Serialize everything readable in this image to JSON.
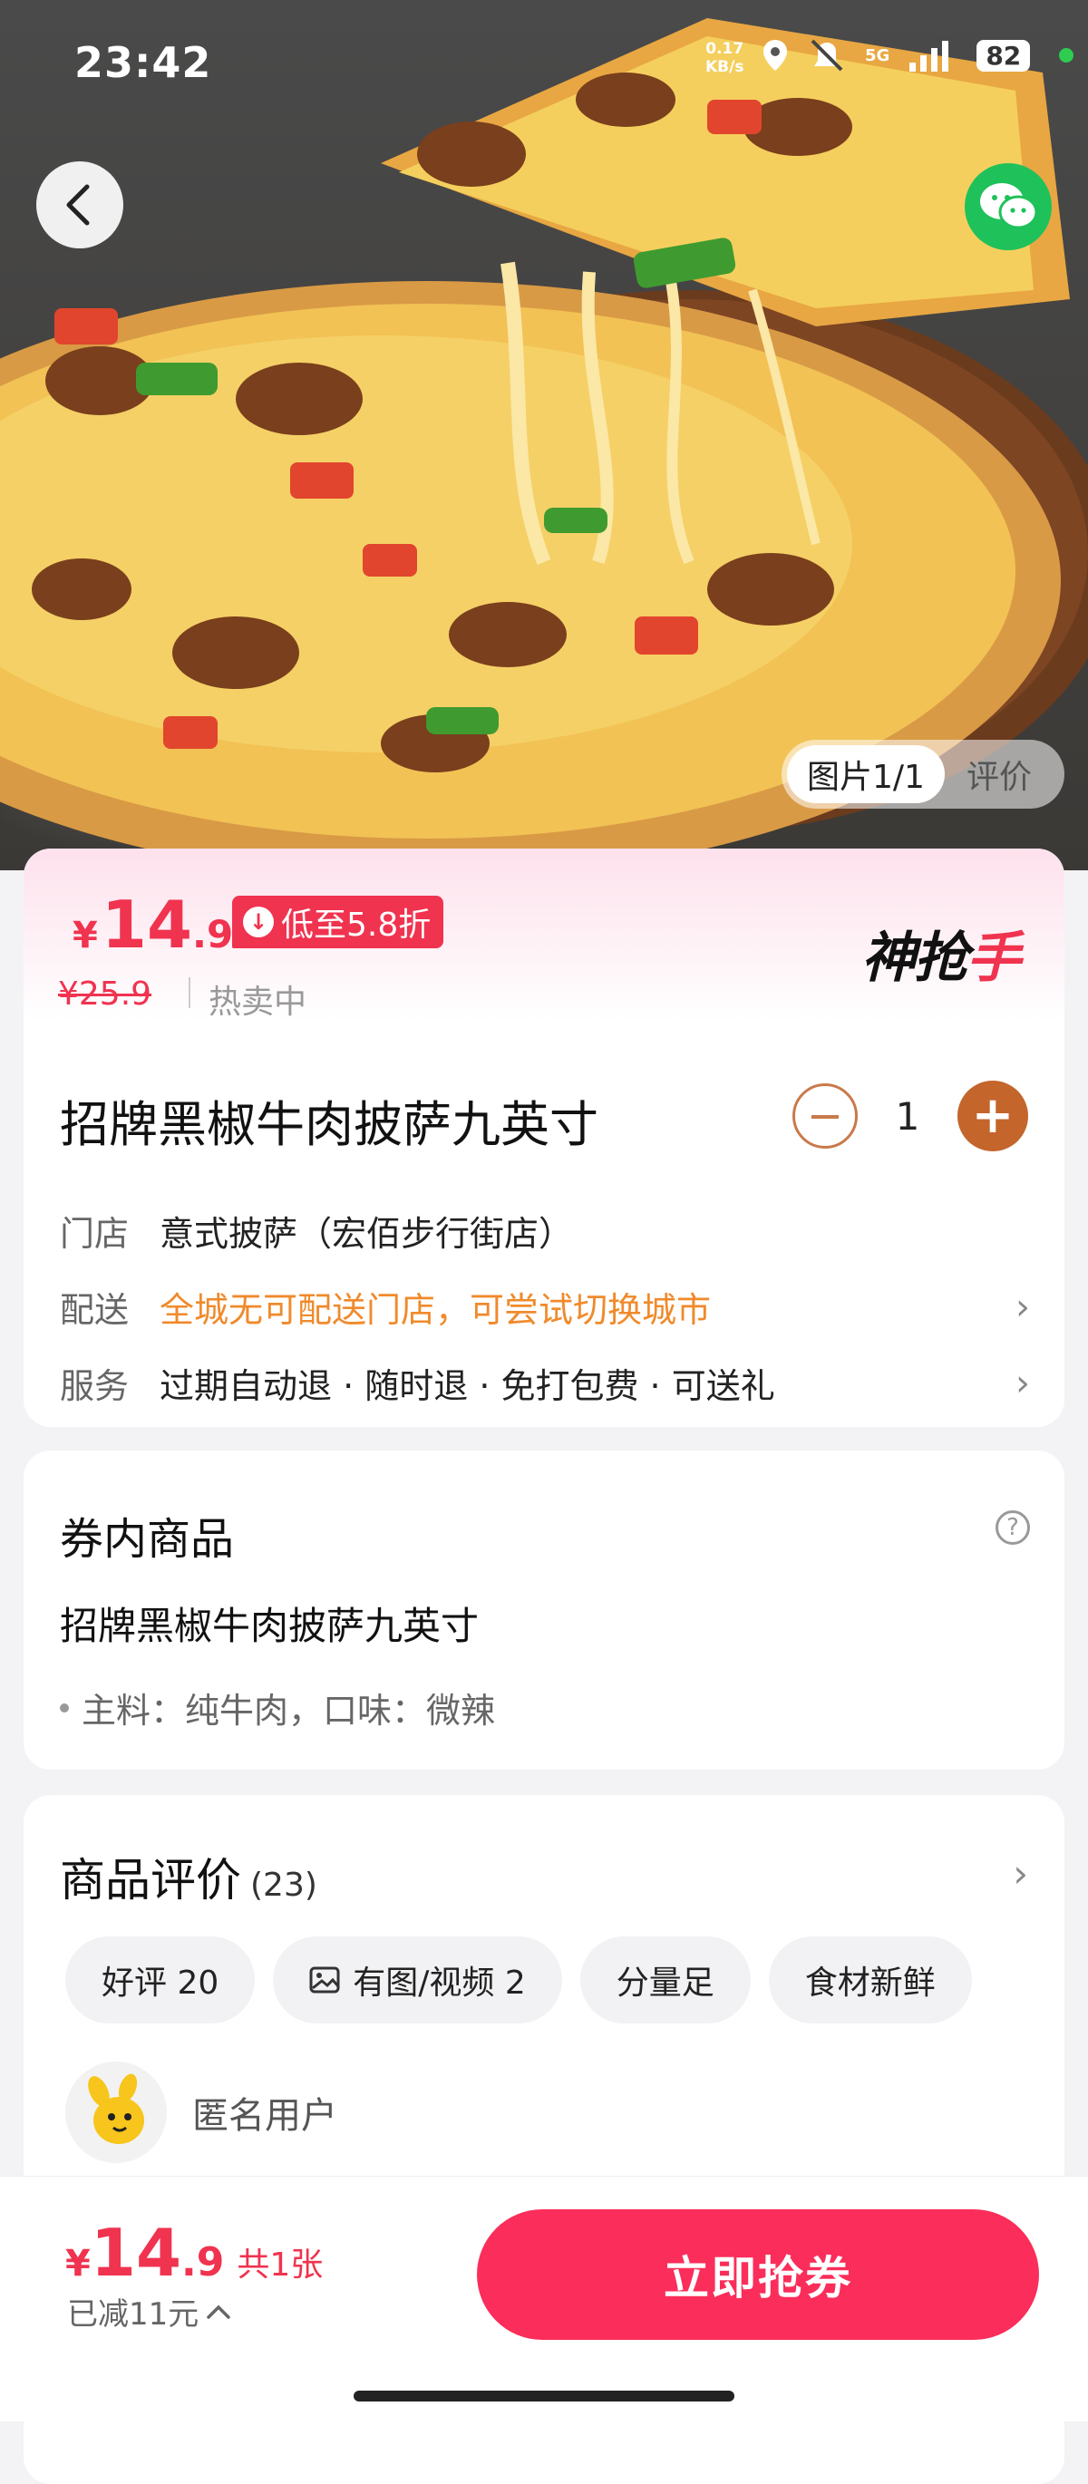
{
  "status_bar": {
    "time": "23:42",
    "net_speed_value": "0.17",
    "net_speed_unit": "KB/s",
    "network": "5G",
    "battery": "82"
  },
  "hero": {
    "image_counter": "图片1/1",
    "review_tab": "评价",
    "icons": [
      "back-icon",
      "wechat-icon"
    ]
  },
  "price": {
    "currency": "¥",
    "current_int": "14",
    "current_dec": ".9",
    "discount": "低至5.8折",
    "original": "¥25.9",
    "status": "热卖中",
    "brand_main": "神抢",
    "brand_accent": "手"
  },
  "product": {
    "title": "招牌黑椒牛肉披萨九英寸",
    "quantity": "1",
    "minus": "−",
    "plus": "+",
    "store_label": "门店",
    "store_value": "意式披萨（宏佰步行街店）",
    "delivery_label": "配送",
    "delivery_value": "全城无可配送门店，可尝试切换城市",
    "service_label": "服务",
    "service_value": "过期自动退 · 随时退 · 免打包费 · 可送礼"
  },
  "contents": {
    "title": "券内商品",
    "item": "招牌黑椒牛肉披萨九英寸",
    "detail": "主料：纯牛肉，口味：微辣"
  },
  "reviews": {
    "title": "商品评价",
    "count": "(23)",
    "tags": [
      "好评 20",
      "有图/视频 2",
      "分量足",
      "食材新鲜"
    ],
    "reviewer": "匿名用户"
  },
  "bottom": {
    "currency": "¥",
    "price_int": "14",
    "price_dec": ".9",
    "count": "共1张",
    "saved": "已减11元",
    "button": "立即抢券"
  },
  "colors": {
    "accent": "#f0334f",
    "button": "#fb2d5a",
    "orange_text": "#f08a2b",
    "qty_plus": "#c4652c"
  }
}
